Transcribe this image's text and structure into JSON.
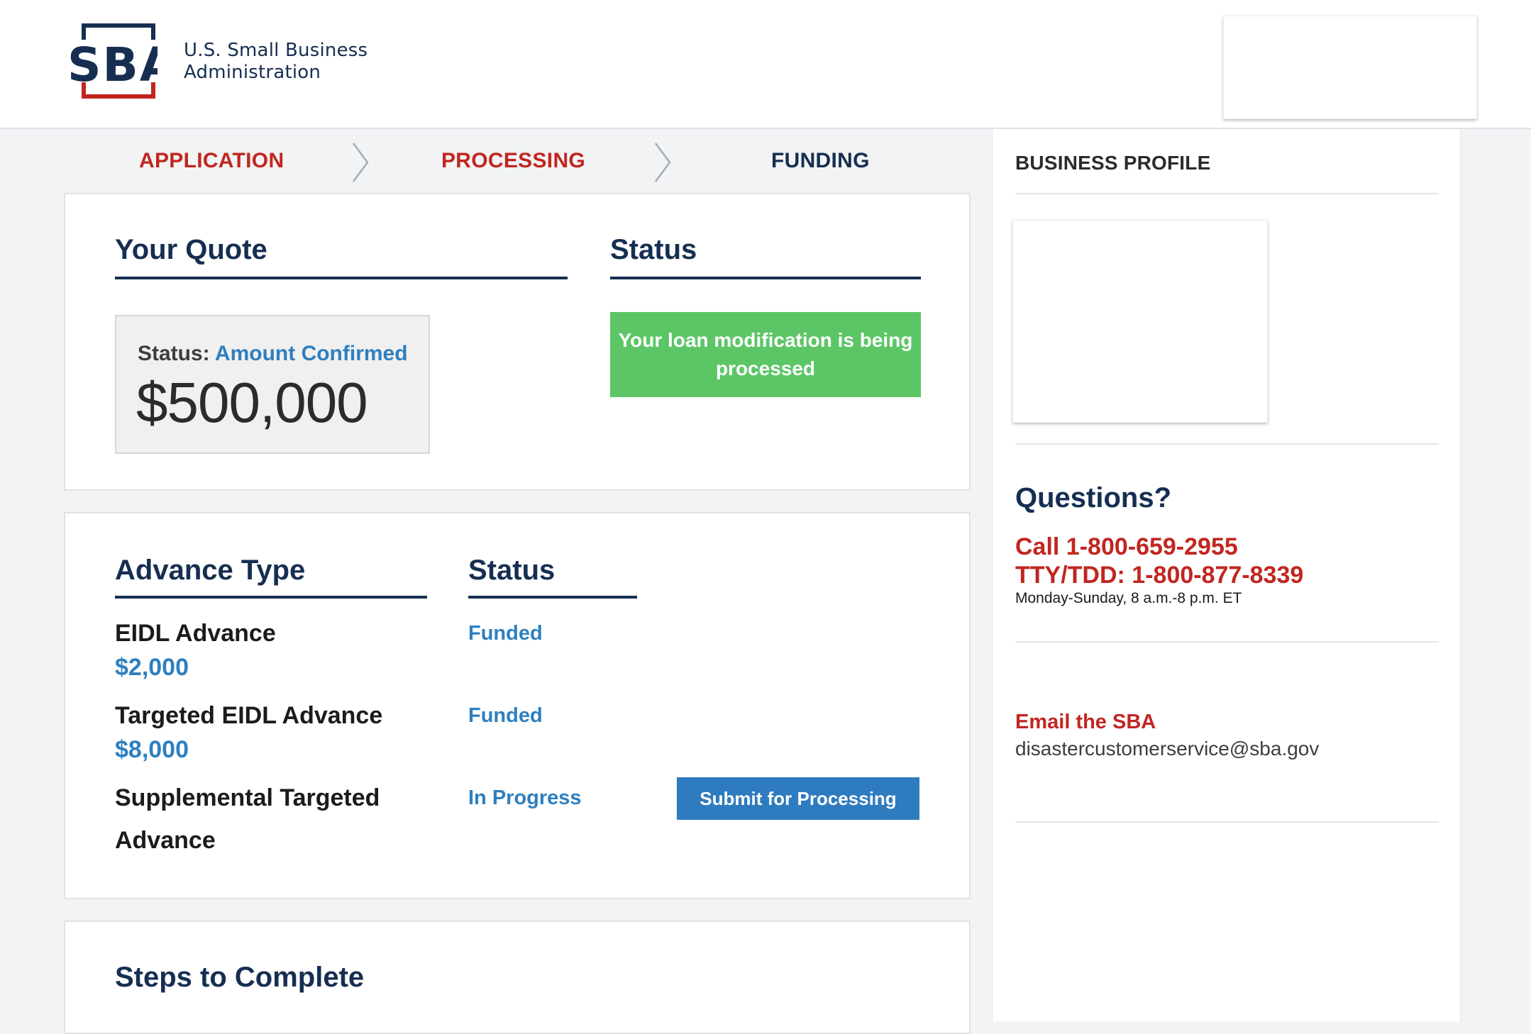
{
  "header": {
    "logo": {
      "acronym": "SBA",
      "line1": "U.S. Small Business",
      "line2": "Administration"
    }
  },
  "progress": {
    "steps": [
      {
        "label": "APPLICATION",
        "state": "complete"
      },
      {
        "label": "PROCESSING",
        "state": "current"
      },
      {
        "label": "FUNDING",
        "state": "pending"
      }
    ]
  },
  "quote": {
    "heading": "Your Quote",
    "status_label": "Status:",
    "status_value": "Amount Confirmed",
    "amount": "$500,000"
  },
  "status": {
    "heading": "Status",
    "message": "Your loan modification is being processed"
  },
  "advances": {
    "type_heading": "Advance Type",
    "status_heading": "Status",
    "items": [
      {
        "name": "EIDL Advance",
        "amount": "$2,000",
        "status": "Funded"
      },
      {
        "name": "Targeted EIDL Advance",
        "amount": "$8,000",
        "status": "Funded"
      },
      {
        "name_line1": "Supplemental Targeted",
        "name_line2": "Advance",
        "status": "In Progress",
        "action_label": "Submit for Processing"
      }
    ]
  },
  "steps_to_complete": {
    "heading": "Steps to Complete"
  },
  "sidebar": {
    "business_profile_heading": "BUSINESS PROFILE",
    "questions": {
      "heading": "Questions?",
      "phone": "Call 1-800-659-2955",
      "tty": "TTY/TDD: 1-800-877-8339",
      "hours": "Monday-Sunday, 8 a.m.-8 p.m. ET"
    },
    "email": {
      "heading": "Email the SBA",
      "address": "disastercustomerservice@sba.gov"
    }
  },
  "colors": {
    "navy": "#162e51",
    "red": "#c1261f",
    "blue": "#2e7fbf",
    "green": "#5cc666",
    "background": "#f2f3f5"
  }
}
